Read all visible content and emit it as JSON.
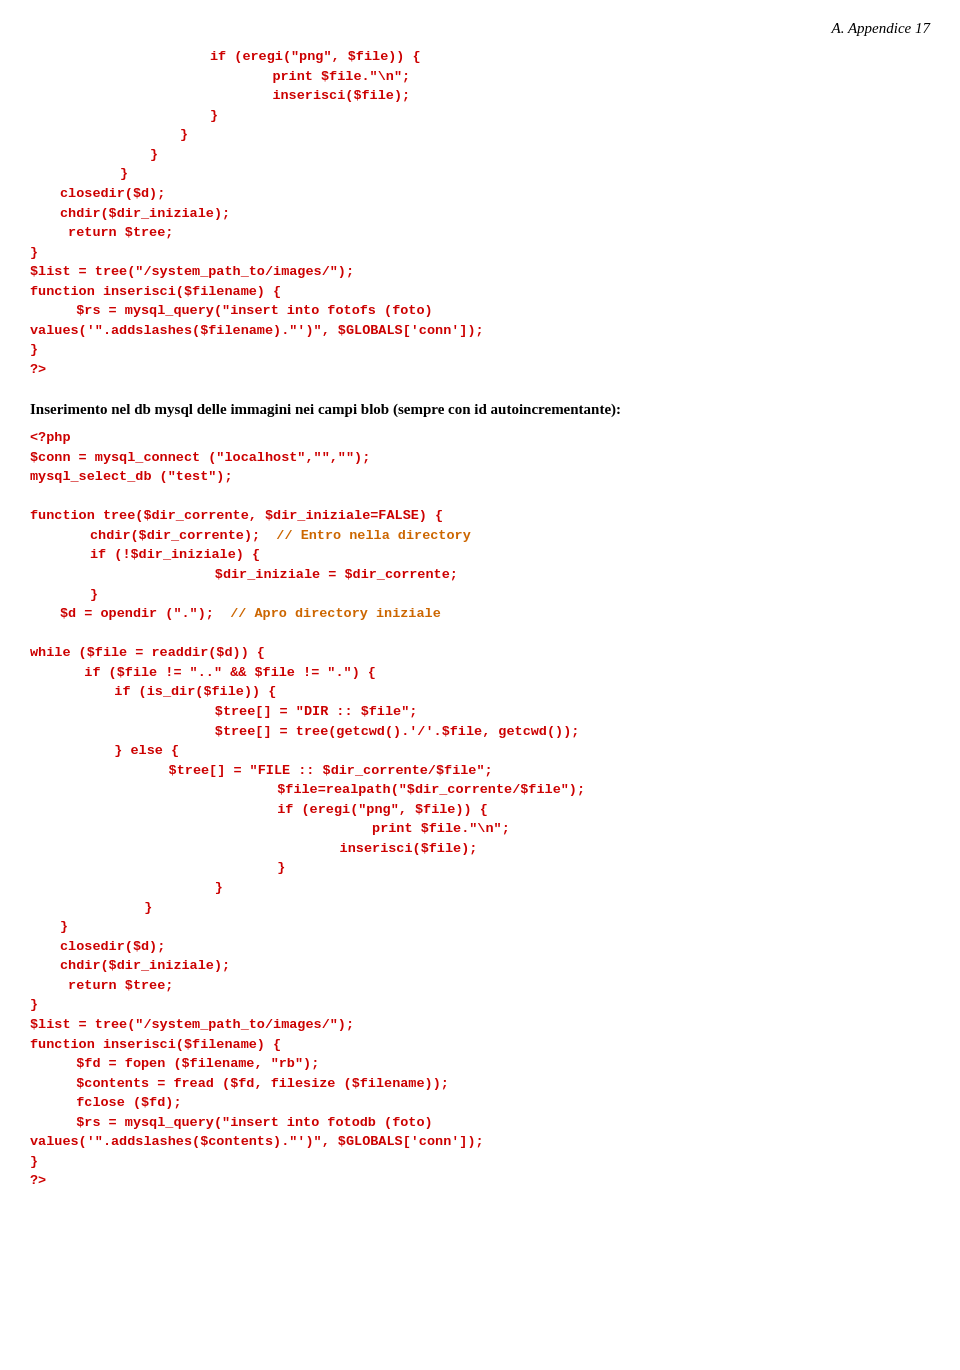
{
  "header": {
    "text": "A. Appendice 17"
  },
  "page": {
    "prose1": "Inserimento nel db mysql delle immagini nei campi blob (sempre con id autoincrementante):"
  }
}
